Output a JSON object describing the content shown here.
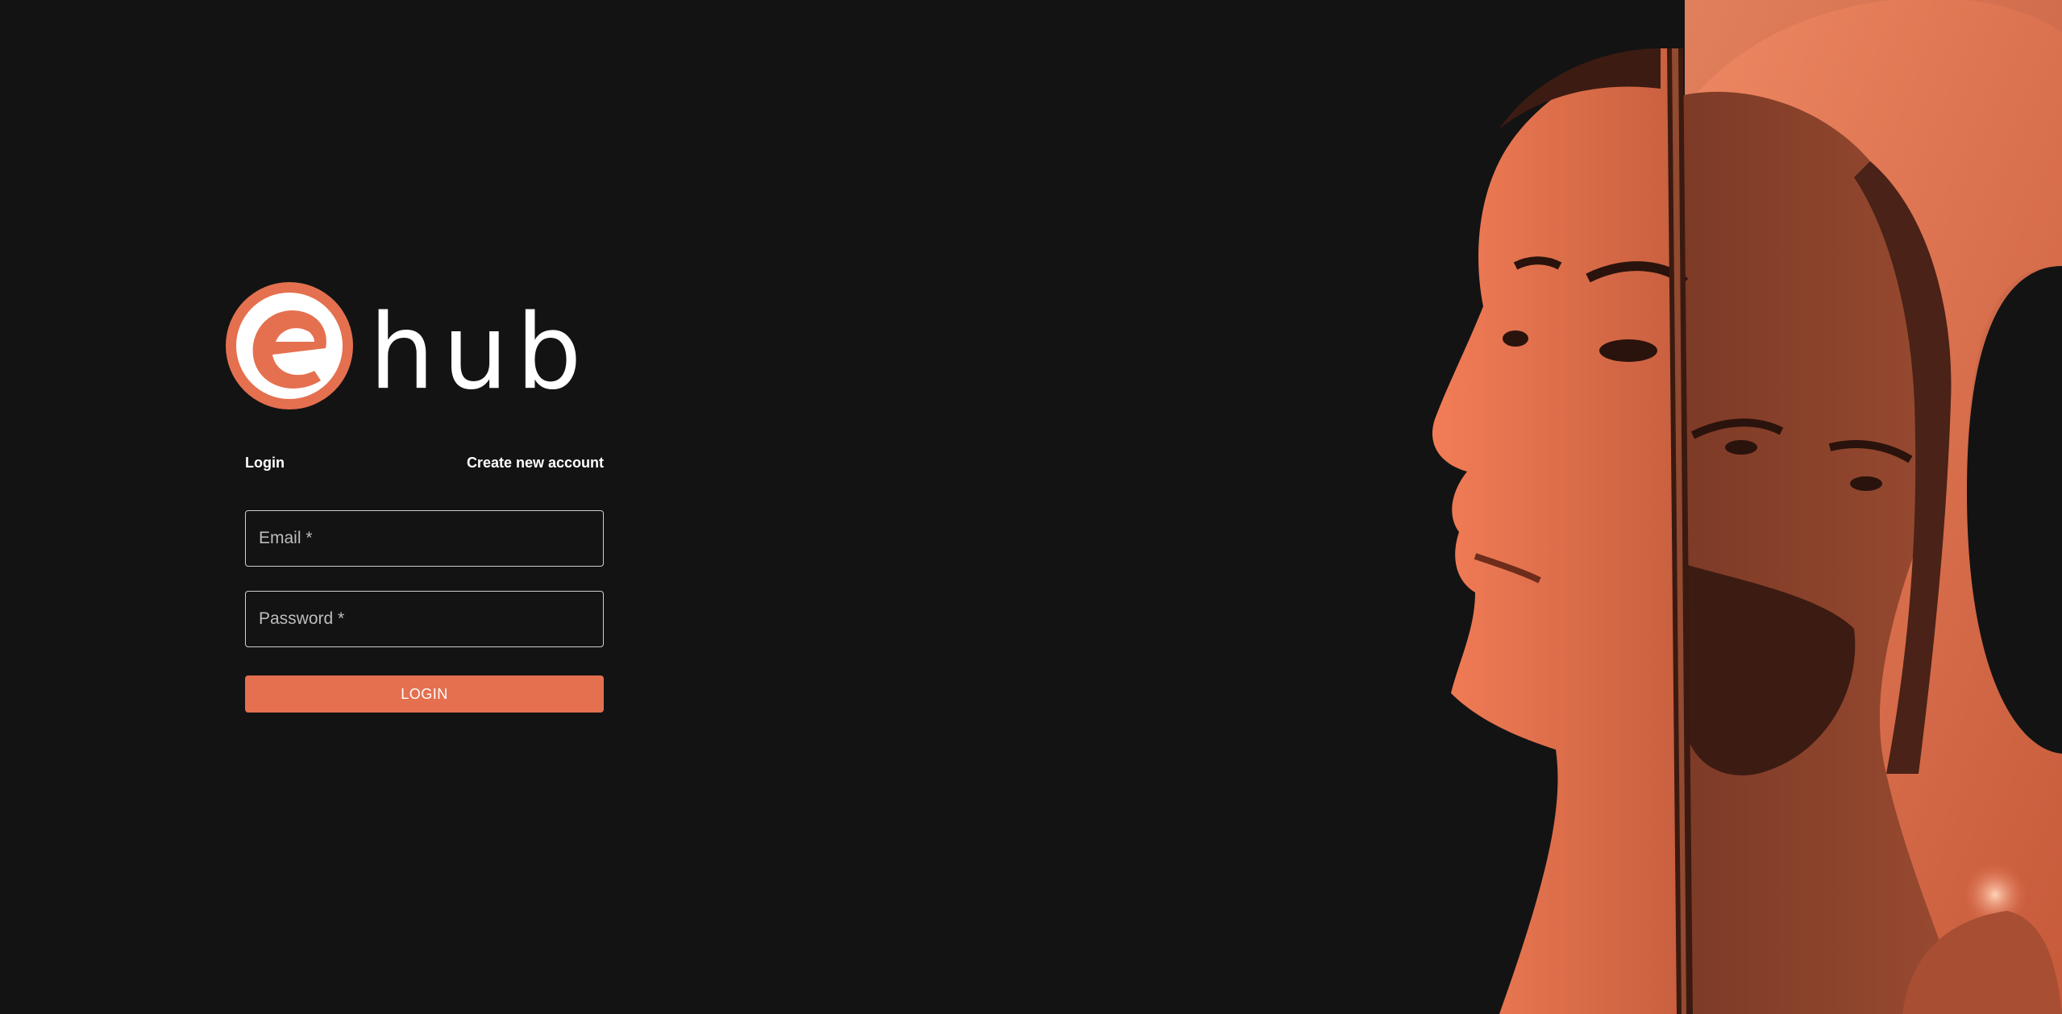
{
  "brand": {
    "logo_letter": "e",
    "logo_word": "hub",
    "accent_color": "#e4704f"
  },
  "tabs": {
    "login_label": "Login",
    "create_label": "Create new account"
  },
  "form": {
    "email_placeholder": "Email *",
    "password_placeholder": "Password *",
    "submit_label": "LOGIN"
  },
  "hero": {
    "icon": "poster-artwork-two-faces"
  }
}
